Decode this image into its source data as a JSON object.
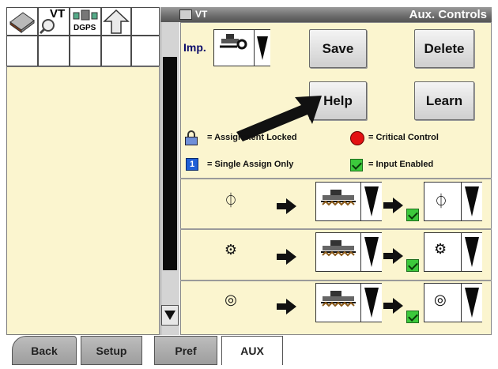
{
  "shortcuts": {
    "items": [
      {
        "icon": "book-icon",
        "label": ""
      },
      {
        "icon": "vt-magnifier-icon",
        "label": "VT"
      },
      {
        "icon": "dgps-satellite-icon",
        "label": "DGPS"
      },
      {
        "icon": "up-arrow-icon",
        "label": ""
      }
    ]
  },
  "window": {
    "vt_label": "VT",
    "title": "Aux. Controls"
  },
  "implement": {
    "label": "Imp."
  },
  "buttons": {
    "save": "Save",
    "delete": "Delete",
    "help": "Help",
    "learn": "Learn"
  },
  "legend": {
    "locked": "= Assignment Locked",
    "critical": "= Critical Control",
    "single": "= Single Assign Only",
    "input_enabled": "= Input Enabled"
  },
  "rows": [
    {
      "function_icon": "power-symbol-icon",
      "glyph": "⏀"
    },
    {
      "function_icon": "settings-small-icon",
      "glyph": "⚙"
    },
    {
      "function_icon": "settings-circle-icon",
      "glyph": "◎"
    }
  ],
  "tabs": {
    "back": "Back",
    "setup": "Setup",
    "pref": "Pref",
    "aux": "AUX"
  },
  "colors": {
    "pane_bg": "#fbf5cf",
    "critical": "#e31212",
    "single": "#1f5fd6",
    "enabled": "#3cc93c"
  }
}
